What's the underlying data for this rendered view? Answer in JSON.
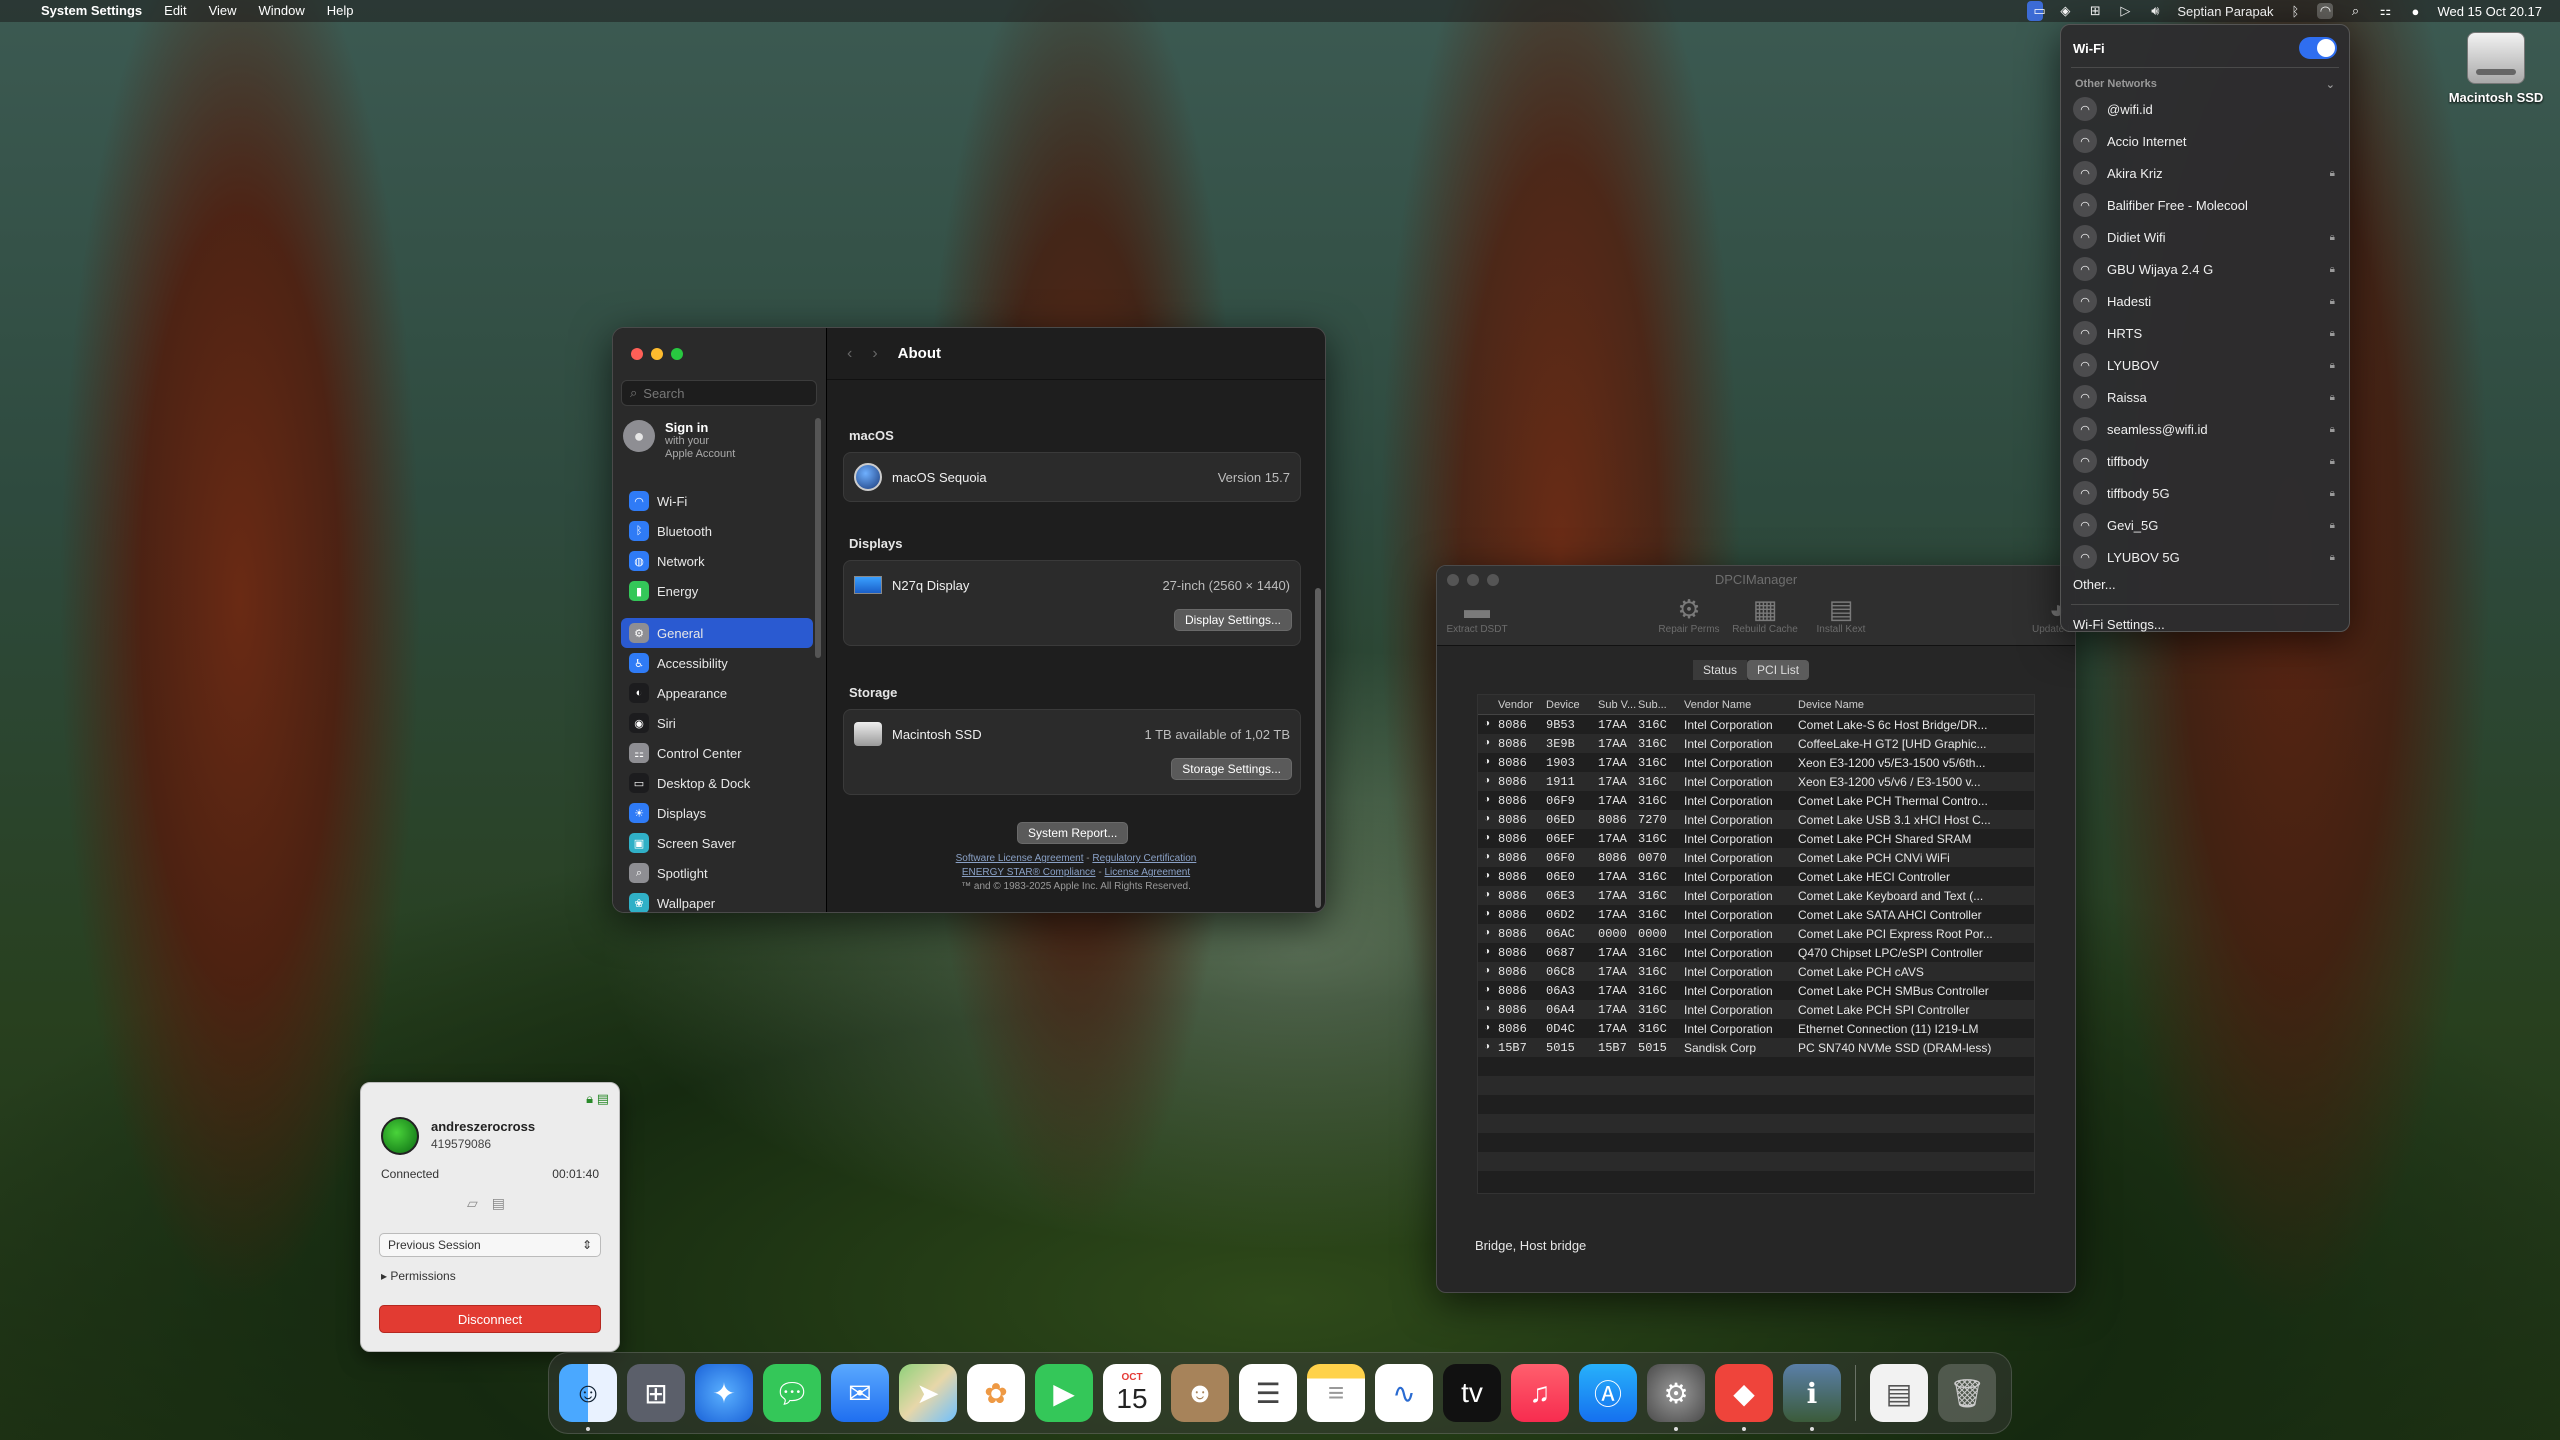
{
  "menubar": {
    "app": "System Settings",
    "menus": [
      "Edit",
      "View",
      "Window",
      "Help"
    ],
    "user": "Septian Parapak",
    "datetime": "Wed 15 Oct  20.17"
  },
  "desktop": {
    "disk_label": "Macintosh SSD"
  },
  "settings": {
    "search_placeholder": "Search",
    "signin_title": "Sign in",
    "signin_sub1": "with your",
    "signin_sub2": "Apple Account",
    "nav": [
      {
        "label": "Wi-Fi",
        "icon": "wifi-icon",
        "color": "#2f7bf6"
      },
      {
        "label": "Bluetooth",
        "icon": "bluetooth-icon",
        "color": "#2f7bf6"
      },
      {
        "label": "Network",
        "icon": "globe-icon",
        "color": "#2f7bf6"
      },
      {
        "label": "Energy",
        "icon": "battery-icon",
        "color": "#34c759"
      },
      {
        "label": "General",
        "icon": "gear-icon",
        "color": "#8e8e93"
      },
      {
        "label": "Accessibility",
        "icon": "accessibility-icon",
        "color": "#2f7bf6"
      },
      {
        "label": "Appearance",
        "icon": "appearance-icon",
        "color": "#1c1c1e"
      },
      {
        "label": "Siri",
        "icon": "siri-icon",
        "color": "#1c1c1e"
      },
      {
        "label": "Control Center",
        "icon": "control-center-icon",
        "color": "#8e8e93"
      },
      {
        "label": "Desktop & Dock",
        "icon": "dock-icon",
        "color": "#1c1c1e"
      },
      {
        "label": "Displays",
        "icon": "displays-icon",
        "color": "#2f7bf6"
      },
      {
        "label": "Screen Saver",
        "icon": "screen-saver-icon",
        "color": "#30b0c7"
      },
      {
        "label": "Spotlight",
        "icon": "spotlight-icon",
        "color": "#8e8e93"
      },
      {
        "label": "Wallpaper",
        "icon": "wallpaper-icon",
        "color": "#30b0c7"
      }
    ],
    "title": "About",
    "macos_header": "macOS",
    "macos_name": "macOS Sequoia",
    "macos_version": "Version 15.7",
    "displays_header": "Displays",
    "display_name": "N27q Display",
    "display_size": "27-inch (2560 × 1440)",
    "display_settings_btn": "Display Settings...",
    "storage_header": "Storage",
    "storage_name": "Macintosh SSD",
    "storage_info": "1 TB available of 1,02 TB",
    "storage_settings_btn": "Storage Settings...",
    "system_report_btn": "System Report...",
    "legal": {
      "software_license": "Software License Agreement",
      "regulatory": "Regulatory Certification",
      "energy_star": "ENERGY STAR® Compliance",
      "license": "License Agreement",
      "copyright": "™ and © 1983-2025 Apple Inc. All Rights Reserved.",
      "separator": "-"
    }
  },
  "dpci": {
    "title": "DPCIManager",
    "tools": [
      "Extract DSDT",
      "Repair Perms",
      "Rebuild Cache",
      "Install Kext",
      "Update IDs"
    ],
    "tabs": [
      "Status",
      "PCI List"
    ],
    "headers": [
      "Vendor",
      "Device",
      "Sub V...",
      "Sub...",
      "Vendor Name",
      "Device Name"
    ],
    "rows": [
      [
        "8086",
        "9B53",
        "17AA",
        "316C",
        "Intel Corporation",
        "Comet Lake-S 6c Host Bridge/DR..."
      ],
      [
        "8086",
        "3E9B",
        "17AA",
        "316C",
        "Intel Corporation",
        "CoffeeLake-H GT2 [UHD Graphic..."
      ],
      [
        "8086",
        "1903",
        "17AA",
        "316C",
        "Intel Corporation",
        "Xeon E3-1200 v5/E3-1500 v5/6th..."
      ],
      [
        "8086",
        "1911",
        "17AA",
        "316C",
        "Intel Corporation",
        "Xeon E3-1200 v5/v6 / E3-1500 v..."
      ],
      [
        "8086",
        "06F9",
        "17AA",
        "316C",
        "Intel Corporation",
        "Comet Lake PCH Thermal Contro..."
      ],
      [
        "8086",
        "06ED",
        "8086",
        "7270",
        "Intel Corporation",
        "Comet Lake USB 3.1 xHCI Host C..."
      ],
      [
        "8086",
        "06EF",
        "17AA",
        "316C",
        "Intel Corporation",
        "Comet Lake PCH Shared SRAM"
      ],
      [
        "8086",
        "06F0",
        "8086",
        "0070",
        "Intel Corporation",
        "Comet Lake PCH CNVi WiFi"
      ],
      [
        "8086",
        "06E0",
        "17AA",
        "316C",
        "Intel Corporation",
        "Comet Lake HECI Controller"
      ],
      [
        "8086",
        "06E3",
        "17AA",
        "316C",
        "Intel Corporation",
        "Comet Lake Keyboard and Text (..."
      ],
      [
        "8086",
        "06D2",
        "17AA",
        "316C",
        "Intel Corporation",
        "Comet Lake SATA AHCI Controller"
      ],
      [
        "8086",
        "06AC",
        "0000",
        "0000",
        "Intel Corporation",
        "Comet Lake PCI Express Root Por..."
      ],
      [
        "8086",
        "0687",
        "17AA",
        "316C",
        "Intel Corporation",
        "Q470 Chipset LPC/eSPI Controller"
      ],
      [
        "8086",
        "06C8",
        "17AA",
        "316C",
        "Intel Corporation",
        "Comet Lake PCH cAVS"
      ],
      [
        "8086",
        "06A3",
        "17AA",
        "316C",
        "Intel Corporation",
        "Comet Lake PCH SMBus Controller"
      ],
      [
        "8086",
        "06A4",
        "17AA",
        "316C",
        "Intel Corporation",
        "Comet Lake PCH SPI Controller"
      ],
      [
        "8086",
        "0D4C",
        "17AA",
        "316C",
        "Intel Corporation",
        "Ethernet Connection (11) I219-LM"
      ],
      [
        "15B7",
        "5015",
        "15B7",
        "5015",
        "Sandisk Corp",
        "PC SN740 NVMe SSD (DRAM-less)"
      ]
    ],
    "status_text": "Bridge, Host bridge"
  },
  "wifi_menu": {
    "title": "Wi-Fi",
    "enabled": true,
    "other_networks_label": "Other Networks",
    "networks": [
      {
        "name": "@wifi.id",
        "locked": false
      },
      {
        "name": "Accio Internet",
        "locked": false
      },
      {
        "name": "Akira Kriz",
        "locked": true
      },
      {
        "name": "Balifiber Free - Molecool",
        "locked": false
      },
      {
        "name": "Didiet Wifi",
        "locked": true
      },
      {
        "name": "GBU Wijaya 2.4 G",
        "locked": true
      },
      {
        "name": "Hadesti",
        "locked": true
      },
      {
        "name": "HRTS",
        "locked": true
      },
      {
        "name": "LYUBOV",
        "locked": true
      },
      {
        "name": "Raissa",
        "locked": true
      },
      {
        "name": "seamless@wifi.id",
        "locked": true
      },
      {
        "name": "tiffbody",
        "locked": true
      },
      {
        "name": "tiffbody 5G",
        "locked": true
      },
      {
        "name": "Gevi_5G",
        "locked": true
      },
      {
        "name": "LYUBOV 5G",
        "locked": true
      }
    ],
    "other_label": "Other...",
    "settings_label": "Wi-Fi Settings..."
  },
  "remote": {
    "name": "andreszerocross",
    "id": "419579086",
    "status": "Connected",
    "time": "00:01:40",
    "session_select": "Previous Session",
    "permissions": "Permissions",
    "disconnect": "Disconnect"
  },
  "dock": {
    "calendar_month": "OCT",
    "calendar_day": "15",
    "apps": [
      "finder-icon",
      "launchpad-icon",
      "safari-icon",
      "messages-icon",
      "mail-icon",
      "maps-icon",
      "photos-icon",
      "facetime-icon",
      "calendar-icon",
      "contacts-icon",
      "reminders-icon",
      "notes-icon",
      "freeform-icon",
      "tv-icon",
      "music-icon",
      "app-store-icon",
      "system-settings-icon",
      "anydesk-icon",
      "dpci-manager-icon",
      "preview-icon",
      "trash-icon"
    ]
  }
}
